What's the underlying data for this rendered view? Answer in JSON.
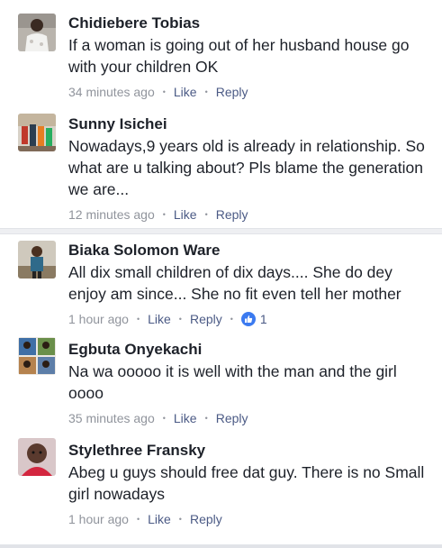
{
  "comments": [
    {
      "name": "Chidiebere Tobias",
      "text": "If a woman is going out of her husband house go with your children OK",
      "time": "34 minutes ago",
      "like": "Like",
      "reply": "Reply"
    },
    {
      "name": "Sunny Isichei",
      "text": "Nowadays,9 years old is already in relationship. So what are u talking about? Pls blame the generation we are...",
      "time": "12 minutes ago",
      "like": "Like",
      "reply": "Reply"
    },
    {
      "name": "Biaka Solomon Ware",
      "text": "All dix small children of dix days.... She do dey enjoy am since... She no fit even tell her mother",
      "time": "1 hour ago",
      "like": "Like",
      "reply": "Reply",
      "reactions": "1"
    },
    {
      "name": "Egbuta Onyekachi",
      "text": "Na wa ooooo  it is well with the man and the girl oooo",
      "time": "35 minutes ago",
      "like": "Like",
      "reply": "Reply"
    },
    {
      "name": "Stylethree Fransky",
      "text": "Abeg u guys should free dat guy.  There is no Small girl nowadays",
      "time": "1 hour ago",
      "like": "Like",
      "reply": "Reply"
    }
  ],
  "icons": {
    "reaction": "thumbs-up-icon",
    "reaction_color": "#3b7af0"
  }
}
